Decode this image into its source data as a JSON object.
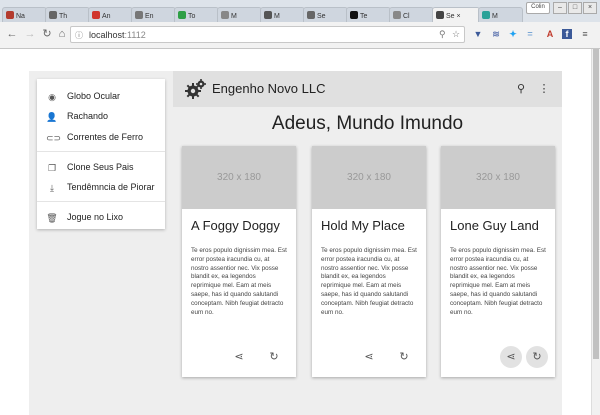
{
  "browser": {
    "tabs": [
      {
        "label": "Na",
        "favicon_color": "#b33b2e"
      },
      {
        "label": "Th",
        "favicon_color": "#666666"
      },
      {
        "label": "An",
        "favicon_color": "#d0342c"
      },
      {
        "label": "En",
        "favicon_color": "#777777"
      },
      {
        "label": "To",
        "favicon_color": "#2e9f45"
      },
      {
        "label": "M",
        "favicon_color": "#888888"
      },
      {
        "label": "M",
        "favicon_color": "#555555"
      },
      {
        "label": "Se",
        "favicon_color": "#666666"
      },
      {
        "label": "Te",
        "favicon_color": "#111111"
      },
      {
        "label": "Cl",
        "favicon_color": "#888888"
      },
      {
        "label": "Se",
        "favicon_color": "#444444",
        "active": true
      },
      {
        "label": "M",
        "favicon_color": "#2aa198"
      }
    ],
    "user_label": "Colin",
    "url_host": "localhost",
    "url_port": ":1112"
  },
  "drawer": {
    "items": [
      {
        "label": "Globo Ocular",
        "icon": "eye-icon"
      },
      {
        "label": "Rachando",
        "icon": "person-add-icon"
      },
      {
        "label": "Correntes de Ferro",
        "icon": "link-icon"
      },
      {
        "label": "Clone Seus Pais",
        "icon": "copy-icon"
      },
      {
        "label": "Tendêmncia de Piorar",
        "icon": "download-icon"
      },
      {
        "label": "Jogue no Lixo",
        "icon": "trash-icon"
      }
    ]
  },
  "header": {
    "title": "Engenho Novo LLC"
  },
  "main": {
    "heading": "Adeus, Mundo Imundo",
    "cards": [
      {
        "image_text": "320 x 180",
        "title": "A Foggy Doggy",
        "text": "Te eros populo dignissim mea. Est error postea iracundia cu, at nostro assentior nec. Vix posse blandit ex, ea legendos reprimique mel. Eam at meis saepe, has id quando salutandi conceptam. Nibh feugiat detracto eum no."
      },
      {
        "image_text": "320 x 180",
        "title": "Hold My Place",
        "text": "Te eros populo dignissim mea. Est error postea iracundia cu, at nostro assentior nec. Vix posse blandit ex, ea legendos reprimique mel. Eam at meis saepe, has id quando salutandi conceptam. Nibh feugiat detracto eum no."
      },
      {
        "image_text": "320 x 180",
        "title": "Lone Guy Land",
        "text": "Te eros populo dignissim mea. Est error postea iracundia cu, at nostro assentior nec. Vix posse blandit ex, ea legendos reprimique mel. Eam at meis saepe, has id quando salutandi conceptam. Nibh feugiat detracto eum no."
      }
    ]
  }
}
